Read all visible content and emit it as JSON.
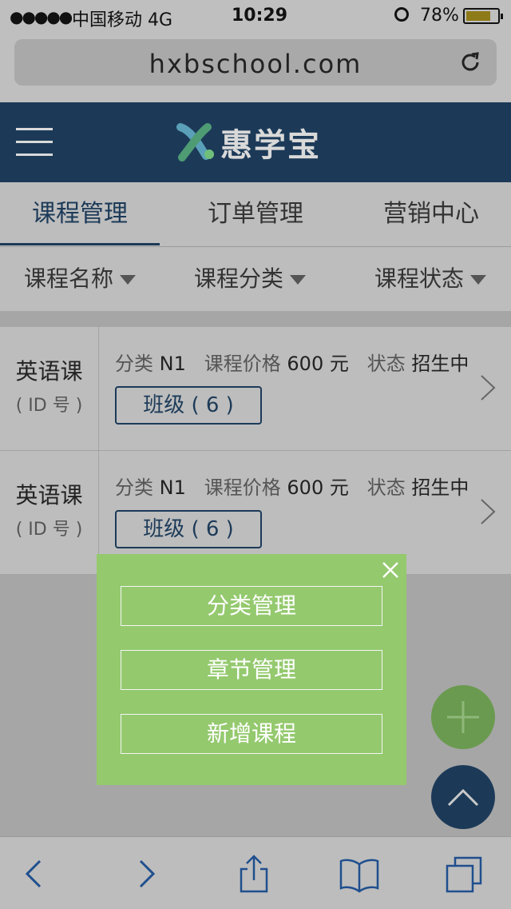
{
  "status_bar": {
    "signal": "●●●●●",
    "carrier": "中国移动  4G",
    "time": "10:29",
    "battery_percent": "78%",
    "battery_level": 0.78
  },
  "browser": {
    "url": "hxbschool.com"
  },
  "app": {
    "brand_name": "惠学宝",
    "colors": {
      "primary": "#1c3a58",
      "popup_green": "#94c96e",
      "fab_green": "#6a9a4f"
    }
  },
  "tabs": [
    {
      "label": "课程管理",
      "active": true
    },
    {
      "label": "订单管理",
      "active": false
    },
    {
      "label": "营销中心",
      "active": false
    }
  ],
  "filters": [
    {
      "label": "课程名称"
    },
    {
      "label": "课程分类"
    },
    {
      "label": "课程状态"
    }
  ],
  "courses": [
    {
      "name": "英语课",
      "id_text": "( ID 号 )",
      "category_label": "分类",
      "category": "N1",
      "price_label": "课程价格",
      "price": "600 元",
      "status_label": "状态",
      "status": "招生中",
      "class_button": "班级 ( 6 )"
    },
    {
      "name": "英语课",
      "id_text": "( ID 号 )",
      "category_label": "分类",
      "category": "N1",
      "price_label": "课程价格",
      "price": "600 元",
      "status_label": "状态",
      "status": "招生中",
      "class_button": "班级 ( 6 )"
    }
  ],
  "popup": {
    "buttons": [
      "分类管理",
      "章节管理",
      "新增课程"
    ]
  },
  "icons": {
    "reload": "reload-icon",
    "menu": "hamburger-menu-icon",
    "add": "plus-icon",
    "scroll_top": "chevron-up-icon",
    "close": "close-icon",
    "back": "chevron-left-icon",
    "forward": "chevron-right-icon",
    "share": "share-icon",
    "bookmarks": "book-icon",
    "tabs": "tabs-icon"
  }
}
